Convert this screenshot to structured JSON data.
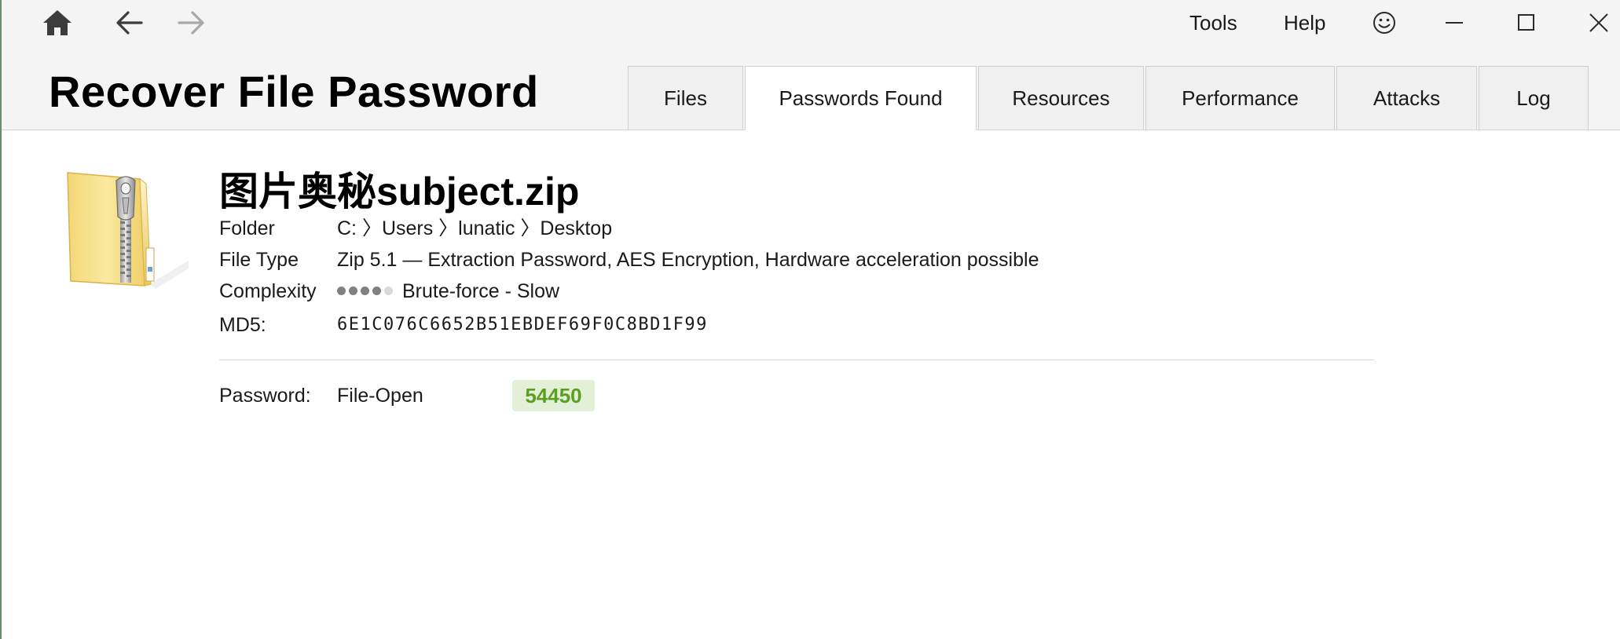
{
  "app": {
    "title": "Recover File Password"
  },
  "menu": {
    "tools": "Tools",
    "help": "Help"
  },
  "icons": {
    "home": "home-icon",
    "back": "arrow-left-icon",
    "forward": "arrow-right-icon",
    "feedback": "smiley-icon",
    "minimize": "minimize-icon",
    "maximize": "maximize-icon",
    "close": "close-icon",
    "file": "zip-folder-icon"
  },
  "tabs": [
    {
      "label": "Files",
      "active": false
    },
    {
      "label": "Passwords Found",
      "active": true
    },
    {
      "label": "Resources",
      "active": false
    },
    {
      "label": "Performance",
      "active": false
    },
    {
      "label": "Attacks",
      "active": false
    },
    {
      "label": "Log",
      "active": false
    }
  ],
  "file": {
    "name": "图片奥秘subject.zip",
    "folder_label": "Folder",
    "folder_value": "C: 〉Users 〉lunatic 〉Desktop",
    "type_label": "File Type",
    "type_value": "Zip 5.1 — Extraction Password, AES Encryption, Hardware acceleration possible",
    "complexity_label": "Complexity",
    "complexity_level": 4,
    "complexity_max": 5,
    "complexity_value": "Brute-force - Slow",
    "md5_label": "MD5:",
    "md5_value": "6E1C076C6652B51EBDEF69F0C8BD1F99"
  },
  "password": {
    "label": "Password:",
    "type": "File-Open",
    "value": "54450"
  },
  "colors": {
    "topbar_bg": "#f4f4f4",
    "tab_bg": "#f0f0f0",
    "tab_active_bg": "#ffffff",
    "password_badge_bg": "#e3efd6",
    "password_text": "#5a9e22",
    "complexity_dot_filled": "#808080",
    "complexity_dot_empty": "#d8d8d8"
  }
}
